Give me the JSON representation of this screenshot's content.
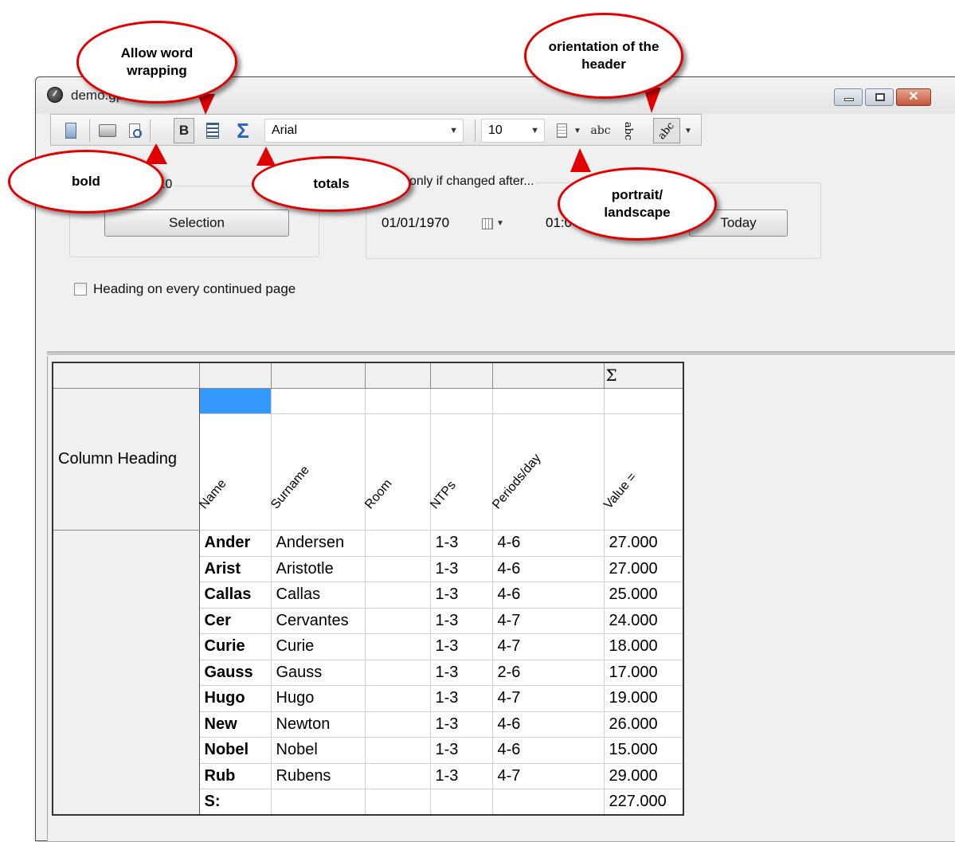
{
  "window": {
    "title": "demo.gpn.z"
  },
  "toolbar": {
    "font_name": "Arial",
    "font_size": "10",
    "abc_label": "abc",
    "abc_vertical_label": "abc",
    "abc_diagonal_label": "abc"
  },
  "options": {
    "selection_group_label": "/10",
    "selection_button": "Selection",
    "changed_group_label": "only if changed after...",
    "date_value": "01/01/1970",
    "time_value": "01:0",
    "today_button": "Today",
    "heading_checkbox_label": "Heading on every continued page",
    "heading_checkbox_checked": false
  },
  "grid": {
    "sigma_header": "Σ",
    "stub_label": "Column Heading",
    "columns": [
      "Name",
      "Surname",
      "Room",
      "NTPs",
      "Periods/day",
      "Value ="
    ],
    "rows": [
      [
        "Ander",
        "Andersen",
        "",
        "1-3",
        "4-6",
        "27.000"
      ],
      [
        "Arist",
        "Aristotle",
        "",
        "1-3",
        "4-6",
        "27.000"
      ],
      [
        "Callas",
        "Callas",
        "",
        "1-3",
        "4-6",
        "25.000"
      ],
      [
        "Cer",
        "Cervantes",
        "",
        "1-3",
        "4-7",
        "24.000"
      ],
      [
        "Curie",
        "Curie",
        "",
        "1-3",
        "4-7",
        "18.000"
      ],
      [
        "Gauss",
        "Gauss",
        "",
        "1-3",
        "2-6",
        "17.000"
      ],
      [
        "Hugo",
        "Hugo",
        "",
        "1-3",
        "4-7",
        "19.000"
      ],
      [
        "New",
        "Newton",
        "",
        "1-3",
        "4-6",
        "26.000"
      ],
      [
        "Nobel",
        "Nobel",
        "",
        "1-3",
        "4-6",
        "15.000"
      ],
      [
        "Rub",
        "Rubens",
        "",
        "1-3",
        "4-7",
        "29.000"
      ]
    ],
    "total_row": [
      "S:",
      "",
      "",
      "",
      "",
      "227.000"
    ]
  },
  "callouts": {
    "word_wrap": "Allow word wrapping",
    "orientation": "orientation of the header",
    "bold": "bold",
    "totals": "totals",
    "portrait": "portrait/ landscape"
  },
  "colors": {
    "callout_border": "#e00000",
    "selected_cell": "#3399ff",
    "sigma_icon": "#2a66b8"
  }
}
